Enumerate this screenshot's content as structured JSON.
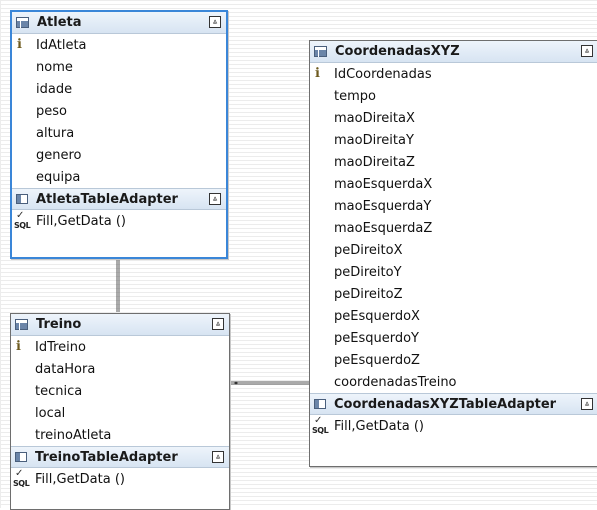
{
  "tables": {
    "atleta": {
      "title": "Atleta",
      "key": "IdAtleta",
      "fields": [
        "nome",
        "idade",
        "peso",
        "altura",
        "genero",
        "equipa"
      ],
      "adapter": "AtletaTableAdapter",
      "method": "Fill,GetData ()"
    },
    "treino": {
      "title": "Treino",
      "key": "IdTreino",
      "fields": [
        "dataHora",
        "tecnica",
        "local",
        "treinoAtleta"
      ],
      "adapter": "TreinoTableAdapter",
      "method": "Fill,GetData ()"
    },
    "coordenadas": {
      "title": "CoordenadasXYZ",
      "key": "IdCoordenadas",
      "fields": [
        "tempo",
        "maoDireitaX",
        "maoDireitaY",
        "maoDireitaZ",
        "maoEsquerdaX",
        "maoEsquerdaY",
        "maoEsquerdaZ",
        "peDireitoX",
        "peDireitoY",
        "peDireitoZ",
        "peEsquerdoX",
        "peEsquerdoY",
        "peEsquerdoZ",
        "coordenadasTreino"
      ],
      "adapter": "CoordenadasXYZTableAdapter",
      "method": "Fill,GetData ()"
    }
  },
  "icons": {
    "collapse": "⩓",
    "key": "🔑",
    "sql_label": "SQL",
    "check": "✓"
  },
  "colors": {
    "selection_border": "#3a86d8",
    "header_bg": "#d7e4f2"
  }
}
